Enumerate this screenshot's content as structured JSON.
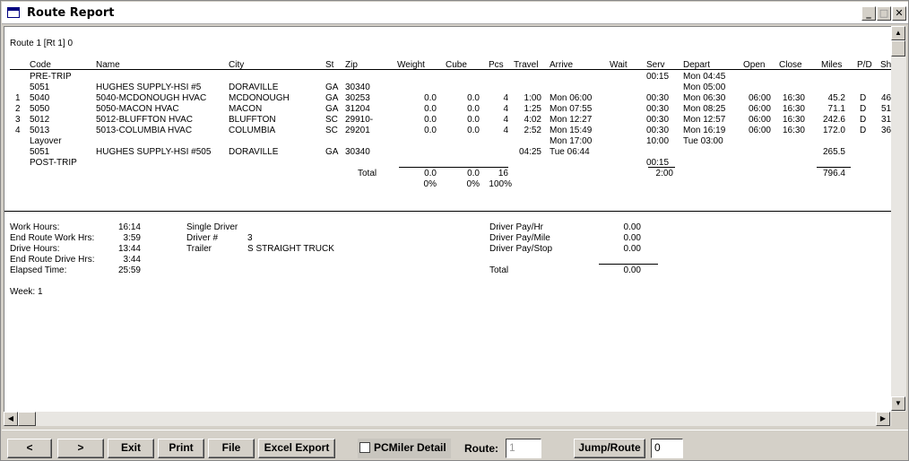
{
  "window": {
    "title": "Route Report"
  },
  "title_buttons": {
    "min": "_",
    "max": "□",
    "close": "✕"
  },
  "report": {
    "route_title": "Route 1 [Rt 1] 0",
    "headers": [
      "Code",
      "Name",
      "City",
      "St",
      "Zip",
      "Weight",
      "Cube",
      "Pcs",
      "Travel",
      "Arrive",
      "Wait",
      "Serv",
      "Depart",
      "Open",
      "Close",
      "Miles",
      "P/D",
      "Sh"
    ],
    "rows": [
      {
        "num": "",
        "code": "PRE-TRIP",
        "name": "",
        "city": "",
        "st": "",
        "zip": "",
        "weight": "",
        "cube": "",
        "pcs": "",
        "travel": "",
        "arrive": "",
        "wait": "",
        "serv": "00:15",
        "depart": "Mon 04:45",
        "open": "",
        "close": "",
        "miles": "",
        "pd": "",
        "sh": ""
      },
      {
        "num": "",
        "code": "5051",
        "name": "HUGHES SUPPLY-HSI #5",
        "city": "DORAVILLE",
        "st": "GA",
        "zip": "30340",
        "weight": "",
        "cube": "",
        "pcs": "",
        "travel": "",
        "arrive": "",
        "wait": "",
        "serv": "",
        "depart": "Mon 05:00",
        "open": "",
        "close": "",
        "miles": "",
        "pd": "",
        "sh": ""
      },
      {
        "num": "1",
        "code": "5040",
        "name": "5040-MCDONOUGH HVAC",
        "city": "MCDONOUGH",
        "st": "GA",
        "zip": "30253",
        "weight": "0.0",
        "cube": "0.0",
        "pcs": "4",
        "travel": "1:00",
        "arrive": "Mon 06:00",
        "wait": "",
        "serv": "00:30",
        "depart": "Mon 06:30",
        "open": "06:00",
        "close": "16:30",
        "miles": "45.2",
        "pd": "D",
        "sh": "46"
      },
      {
        "num": "2",
        "code": "5050",
        "name": "5050-MACON HVAC",
        "city": "MACON",
        "st": "GA",
        "zip": "31204",
        "weight": "0.0",
        "cube": "0.0",
        "pcs": "4",
        "travel": "1:25",
        "arrive": "Mon 07:55",
        "wait": "",
        "serv": "00:30",
        "depart": "Mon 08:25",
        "open": "06:00",
        "close": "16:30",
        "miles": "71.1",
        "pd": "D",
        "sh": "51"
      },
      {
        "num": "3",
        "code": "5012",
        "name": "5012-BLUFFTON HVAC",
        "city": "BLUFFTON",
        "st": "SC",
        "zip": "29910-",
        "weight": "0.0",
        "cube": "0.0",
        "pcs": "4",
        "travel": "4:02",
        "arrive": "Mon 12:27",
        "wait": "",
        "serv": "00:30",
        "depart": "Mon 12:57",
        "open": "06:00",
        "close": "16:30",
        "miles": "242.6",
        "pd": "D",
        "sh": "31"
      },
      {
        "num": "4",
        "code": "5013",
        "name": "5013-COLUMBIA HVAC",
        "city": "COLUMBIA",
        "st": "SC",
        "zip": "29201",
        "weight": "0.0",
        "cube": "0.0",
        "pcs": "4",
        "travel": "2:52",
        "arrive": "Mon 15:49",
        "wait": "",
        "serv": "00:30",
        "depart": "Mon 16:19",
        "open": "06:00",
        "close": "16:30",
        "miles": "172.0",
        "pd": "D",
        "sh": "36"
      },
      {
        "num": "",
        "code": "Layover",
        "name": "",
        "city": "",
        "st": "",
        "zip": "",
        "weight": "",
        "cube": "",
        "pcs": "",
        "travel": "",
        "arrive": "Mon 17:00",
        "wait": "",
        "serv": "10:00",
        "depart": "Tue 03:00",
        "open": "",
        "close": "",
        "miles": "",
        "pd": "",
        "sh": ""
      },
      {
        "num": "",
        "code": "5051",
        "name": "HUGHES SUPPLY-HSI #505",
        "city": "DORAVILLE",
        "st": "GA",
        "zip": "30340",
        "weight": "",
        "cube": "",
        "pcs": "",
        "travel": "04:25",
        "arrive": "Tue 06:44",
        "wait": "",
        "serv": "",
        "depart": "",
        "open": "",
        "close": "",
        "miles": "265.5",
        "pd": "",
        "sh": ""
      },
      {
        "num": "",
        "code": "POST-TRIP",
        "name": "",
        "city": "",
        "st": "",
        "zip": "",
        "weight": "",
        "cube": "",
        "pcs": "",
        "travel": "",
        "arrive": "",
        "wait": "",
        "serv": "00:15",
        "depart": "",
        "open": "",
        "close": "",
        "miles": "",
        "pd": "",
        "sh": ""
      }
    ],
    "totals": {
      "label": "Total",
      "weight": "0.0",
      "cube": "0.0",
      "pcs": "16",
      "serv": "2:00",
      "miles": "796.4"
    },
    "percents": {
      "weight": "0%",
      "cube": "0%",
      "pcs": "100%"
    },
    "summary": {
      "left": [
        {
          "label": "Work Hours:",
          "value": "16:14"
        },
        {
          "label": "End Route Work Hrs:",
          "value": "3:59"
        },
        {
          "label": "Drive Hours:",
          "value": "13:44"
        },
        {
          "label": "End Route Drive Hrs:",
          "value": "3:44"
        },
        {
          "label": "Elapsed Time:",
          "value": "25:59"
        }
      ],
      "driver_type": "Single Driver",
      "driver_label": "Driver #",
      "driver_value": "3",
      "trailer_label": "Trailer",
      "trailer_value": "S STRAIGHT TRUCK",
      "pay": [
        {
          "label": "Driver Pay/Hr",
          "value": "0.00"
        },
        {
          "label": "Driver Pay/Mile",
          "value": "0.00"
        },
        {
          "label": "Driver Pay/Stop",
          "value": "0.00"
        }
      ],
      "pay_total_label": "Total",
      "pay_total_value": "0.00",
      "week": "Week: 1"
    }
  },
  "toolbar": {
    "prev": "<",
    "next": ">",
    "exit": "Exit",
    "print": "Print",
    "file": "File",
    "excel": "Excel Export",
    "pcmiler": "PCMiler Detail",
    "route_label": "Route:",
    "route_value": "1",
    "jump": "Jump/Route",
    "jump_value": "0"
  }
}
